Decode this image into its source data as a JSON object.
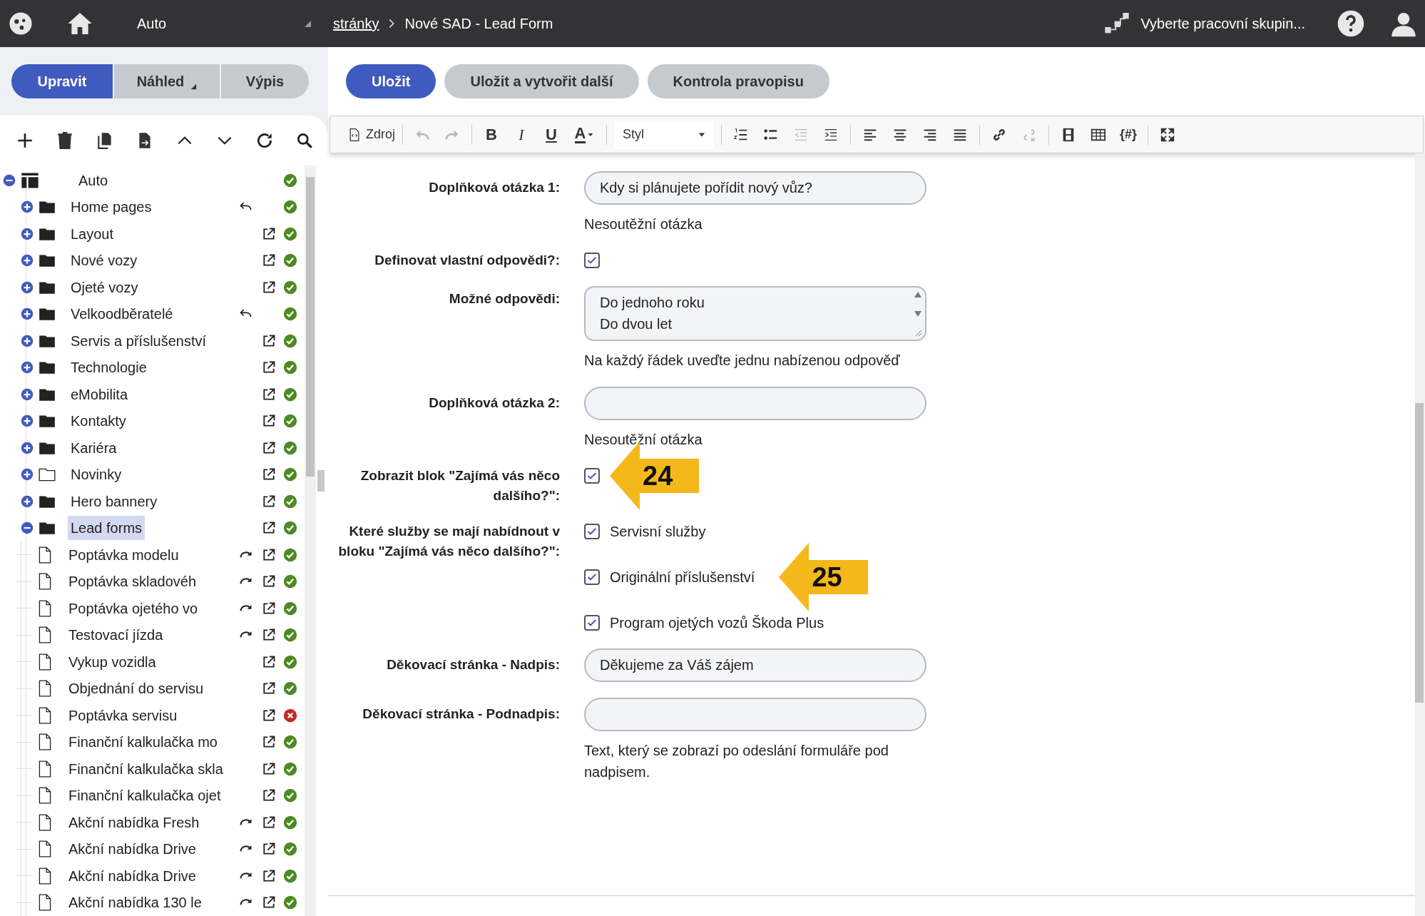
{
  "top_bar": {
    "site": "Auto",
    "breadcrumb": [
      {
        "text": "stránky",
        "link": true
      },
      {
        "text": "Nové SAD - Lead Form",
        "link": false
      }
    ],
    "workgroup": "Vyberte pracovní skupin..."
  },
  "left_tabs": [
    {
      "label": "Upravit",
      "selected": true,
      "dropdown": false
    },
    {
      "label": "Náhled",
      "selected": false,
      "dropdown": true
    },
    {
      "label": "Výpis",
      "selected": false,
      "dropdown": false
    }
  ],
  "tree": [
    {
      "label": "Auto",
      "kind": "layout",
      "expanded": true,
      "selected": false,
      "reverted": false,
      "redirect": false,
      "external": false,
      "error": false,
      "children": [
        {
          "label": "Home pages",
          "kind": "folder",
          "expanded": false,
          "selected": false,
          "reverted": true,
          "redirect": false,
          "external": false,
          "error": false
        },
        {
          "label": "Layout",
          "kind": "folder",
          "expanded": false,
          "selected": false,
          "reverted": false,
          "redirect": false,
          "external": true,
          "error": false
        },
        {
          "label": "Nové vozy",
          "kind": "folder",
          "expanded": false,
          "selected": false,
          "reverted": false,
          "redirect": false,
          "external": true,
          "error": false
        },
        {
          "label": "Ojeté vozy",
          "kind": "folder",
          "expanded": false,
          "selected": false,
          "reverted": false,
          "redirect": false,
          "external": true,
          "error": false
        },
        {
          "label": "Velkoodběratelé",
          "kind": "folder",
          "expanded": false,
          "selected": false,
          "reverted": true,
          "redirect": false,
          "external": false,
          "error": false
        },
        {
          "label": "Servis a příslušenství",
          "kind": "folder",
          "expanded": false,
          "selected": false,
          "reverted": false,
          "redirect": false,
          "external": true,
          "error": false
        },
        {
          "label": "Technologie",
          "kind": "folder",
          "expanded": false,
          "selected": false,
          "reverted": false,
          "redirect": false,
          "external": true,
          "error": false
        },
        {
          "label": "eMobilita",
          "kind": "folder",
          "expanded": false,
          "selected": false,
          "reverted": false,
          "redirect": false,
          "external": true,
          "error": false
        },
        {
          "label": "Kontakty",
          "kind": "folder",
          "expanded": false,
          "selected": false,
          "reverted": false,
          "redirect": false,
          "external": true,
          "error": false
        },
        {
          "label": "Kariéra",
          "kind": "folder",
          "expanded": false,
          "selected": false,
          "reverted": false,
          "redirect": false,
          "external": true,
          "error": false
        },
        {
          "label": "Novinky",
          "kind": "empty-folder",
          "expanded": false,
          "selected": false,
          "reverted": false,
          "redirect": false,
          "external": true,
          "error": false
        },
        {
          "label": "Hero bannery",
          "kind": "folder",
          "expanded": false,
          "selected": false,
          "reverted": false,
          "redirect": false,
          "external": true,
          "error": false
        },
        {
          "label": "Lead forms",
          "kind": "folder",
          "expanded": true,
          "selected": true,
          "reverted": false,
          "redirect": false,
          "external": true,
          "error": false,
          "children": [
            {
              "label": "Poptávka modelu",
              "kind": "page",
              "selected": false,
              "reverted": false,
              "redirect": true,
              "external": true,
              "error": false
            },
            {
              "label": "Poptávka skladovéh",
              "kind": "page",
              "selected": false,
              "reverted": false,
              "redirect": true,
              "external": true,
              "error": false
            },
            {
              "label": "Poptávka ojetého vo",
              "kind": "page",
              "selected": false,
              "reverted": false,
              "redirect": true,
              "external": true,
              "error": false
            },
            {
              "label": "Testovací jízda",
              "kind": "page",
              "selected": false,
              "reverted": false,
              "redirect": true,
              "external": true,
              "error": false
            },
            {
              "label": "Vykup vozidla",
              "kind": "page",
              "selected": false,
              "reverted": false,
              "redirect": false,
              "external": true,
              "error": false
            },
            {
              "label": "Objednání do servisu",
              "kind": "page",
              "selected": false,
              "reverted": false,
              "redirect": false,
              "external": true,
              "error": false
            },
            {
              "label": "Poptávka servisu",
              "kind": "page",
              "selected": false,
              "reverted": false,
              "redirect": false,
              "external": true,
              "error": true
            },
            {
              "label": "Finanční kalkulačka mo",
              "kind": "page",
              "selected": false,
              "reverted": false,
              "redirect": false,
              "external": true,
              "error": false
            },
            {
              "label": "Finanční kalkulačka skla",
              "kind": "page",
              "selected": false,
              "reverted": false,
              "redirect": false,
              "external": true,
              "error": false
            },
            {
              "label": "Finanční kalkulačka ojet",
              "kind": "page",
              "selected": false,
              "reverted": false,
              "redirect": false,
              "external": true,
              "error": false
            },
            {
              "label": "Akční nabídka Fresh",
              "kind": "page",
              "selected": false,
              "reverted": false,
              "redirect": true,
              "external": true,
              "error": false
            },
            {
              "label": "Akční nabídka Drive",
              "kind": "page",
              "selected": false,
              "reverted": false,
              "redirect": true,
              "external": true,
              "error": false
            },
            {
              "label": "Akční nabídka Drive",
              "kind": "page",
              "selected": false,
              "reverted": false,
              "redirect": true,
              "external": true,
              "error": false
            },
            {
              "label": "Akční nabídka 130 le",
              "kind": "page",
              "selected": false,
              "reverted": false,
              "redirect": true,
              "external": true,
              "error": false
            }
          ]
        }
      ]
    }
  ],
  "action_buttons": [
    {
      "label": "Uložit",
      "primary": true
    },
    {
      "label": "Uložit a vytvořit další",
      "primary": false
    },
    {
      "label": "Kontrola pravopisu",
      "primary": false
    }
  ],
  "editor_toolbar": [
    [
      {
        "kind": "source",
        "text": "Zdroj",
        "disabled": false
      }
    ],
    [
      {
        "kind": "undo",
        "disabled": true
      },
      {
        "kind": "redo",
        "disabled": true
      }
    ],
    [
      {
        "kind": "bold",
        "text": "B",
        "disabled": false
      },
      {
        "kind": "italic",
        "text": "I",
        "disabled": false
      },
      {
        "kind": "underline",
        "text": "U",
        "disabled": false
      },
      {
        "kind": "text-color",
        "text": "A",
        "disabled": false
      }
    ],
    [
      {
        "kind": "select",
        "text": "Styl",
        "disabled": false
      }
    ],
    [
      {
        "kind": "numbered-list",
        "disabled": false
      },
      {
        "kind": "bullet-list",
        "disabled": false
      },
      {
        "kind": "outdent",
        "disabled": true
      },
      {
        "kind": "indent",
        "disabled": false
      }
    ],
    [
      {
        "kind": "align-left",
        "disabled": false
      },
      {
        "kind": "align-center",
        "disabled": false
      },
      {
        "kind": "align-right",
        "disabled": false
      },
      {
        "kind": "justify",
        "disabled": false
      }
    ],
    [
      {
        "kind": "link",
        "disabled": false
      },
      {
        "kind": "unlink",
        "disabled": true
      }
    ],
    [
      {
        "kind": "film",
        "disabled": false
      },
      {
        "kind": "table",
        "disabled": false
      },
      {
        "kind": "placeholder",
        "text": "{#}",
        "disabled": false
      }
    ],
    [
      {
        "kind": "maximize",
        "disabled": false
      }
    ]
  ],
  "form": [
    {
      "kind": "text",
      "label": "Doplňková otázka 1:",
      "value": "Kdy si plánujete pořídit nový vůz?",
      "help": "Nesoutěžní otázka"
    },
    {
      "kind": "checkbox",
      "label": "Definovat vlastní odpovědi?:",
      "checked": true
    },
    {
      "kind": "textarea",
      "label": "Možné odpovědi:",
      "lines": [
        "Do jednoho roku",
        "Do dvou let"
      ],
      "help": "Na každý řádek uveďte jednu nabízenou odpověď"
    },
    {
      "kind": "text",
      "label": "Doplňková otázka 2:",
      "help": "Nesoutěžní otázka"
    },
    {
      "kind": "checkbox",
      "label": "Zobrazit blok \"Zajímá vás něco dalšího?\":",
      "checked": true,
      "callout": "24"
    },
    {
      "kind": "checklist",
      "label": "Které služby se mají nabídnout v bloku \"Zajímá vás něco dalšího?\":",
      "options": [
        {
          "label": "Servisní služby",
          "checked": true
        },
        {
          "label": "Originální příslušenství",
          "checked": true,
          "callout": "25"
        },
        {
          "label": "Program ojetých vozů Škoda Plus",
          "checked": true
        }
      ]
    },
    {
      "kind": "text",
      "label": "Děkovací stránka - Nadpis:",
      "value": "Děkujeme za Váš zájem"
    },
    {
      "kind": "text",
      "label": "Děkovací stránka - Podnadpis:",
      "help": "Text, který se zobrazí po odeslání formuláře pod nadpisem."
    }
  ]
}
